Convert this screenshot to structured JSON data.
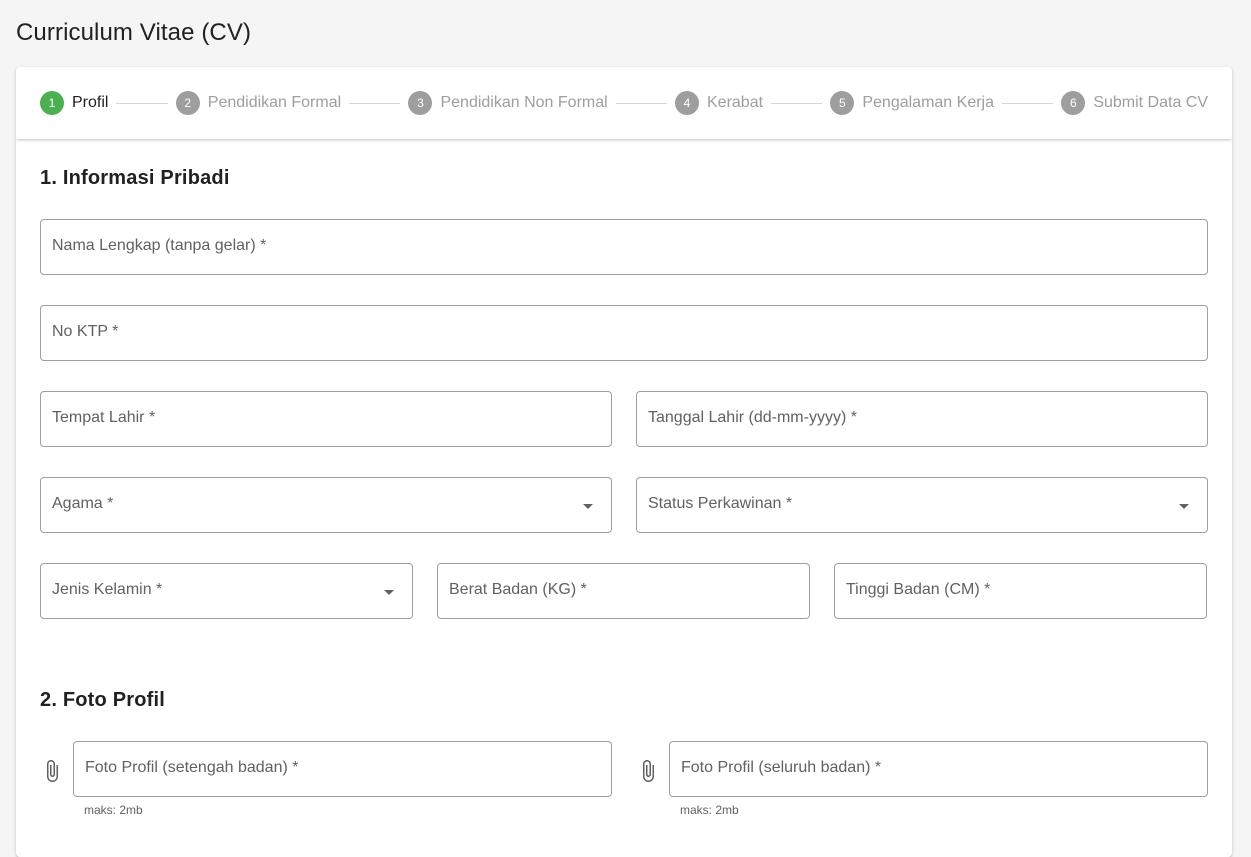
{
  "page": {
    "title": "Curriculum Vitae (CV)"
  },
  "stepper": {
    "steps": [
      {
        "number": "1",
        "label": "Profil",
        "active": true
      },
      {
        "number": "2",
        "label": "Pendidikan Formal",
        "active": false
      },
      {
        "number": "3",
        "label": "Pendidikan Non Formal",
        "active": false
      },
      {
        "number": "4",
        "label": "Kerabat",
        "active": false
      },
      {
        "number": "5",
        "label": "Pengalaman Kerja",
        "active": false
      },
      {
        "number": "6",
        "label": "Submit Data CV",
        "active": false
      }
    ],
    "active_color": "#4caf50",
    "inactive_color": "#9e9e9e"
  },
  "sections": {
    "personal": {
      "title": "1. Informasi Pribadi",
      "fields": {
        "full_name": "Nama Lengkap (tanpa gelar) *",
        "ktp": "No KTP *",
        "birth_place": "Tempat Lahir *",
        "birth_date": "Tanggal Lahir (dd-mm-yyyy) *",
        "religion": "Agama *",
        "marital_status": "Status Perkawinan *",
        "gender": "Jenis Kelamin *",
        "weight": "Berat Badan (KG) *",
        "height": "Tinggi Badan (CM) *"
      }
    },
    "photo": {
      "title": "2. Foto Profil",
      "fields": {
        "half_body": "Foto Profil (setengah badan) *",
        "full_body": "Foto Profil (seluruh badan) *"
      },
      "hints": {
        "half_body": "maks: 2mb",
        "full_body": "maks: 2mb"
      },
      "icon": "paperclip-icon"
    }
  }
}
